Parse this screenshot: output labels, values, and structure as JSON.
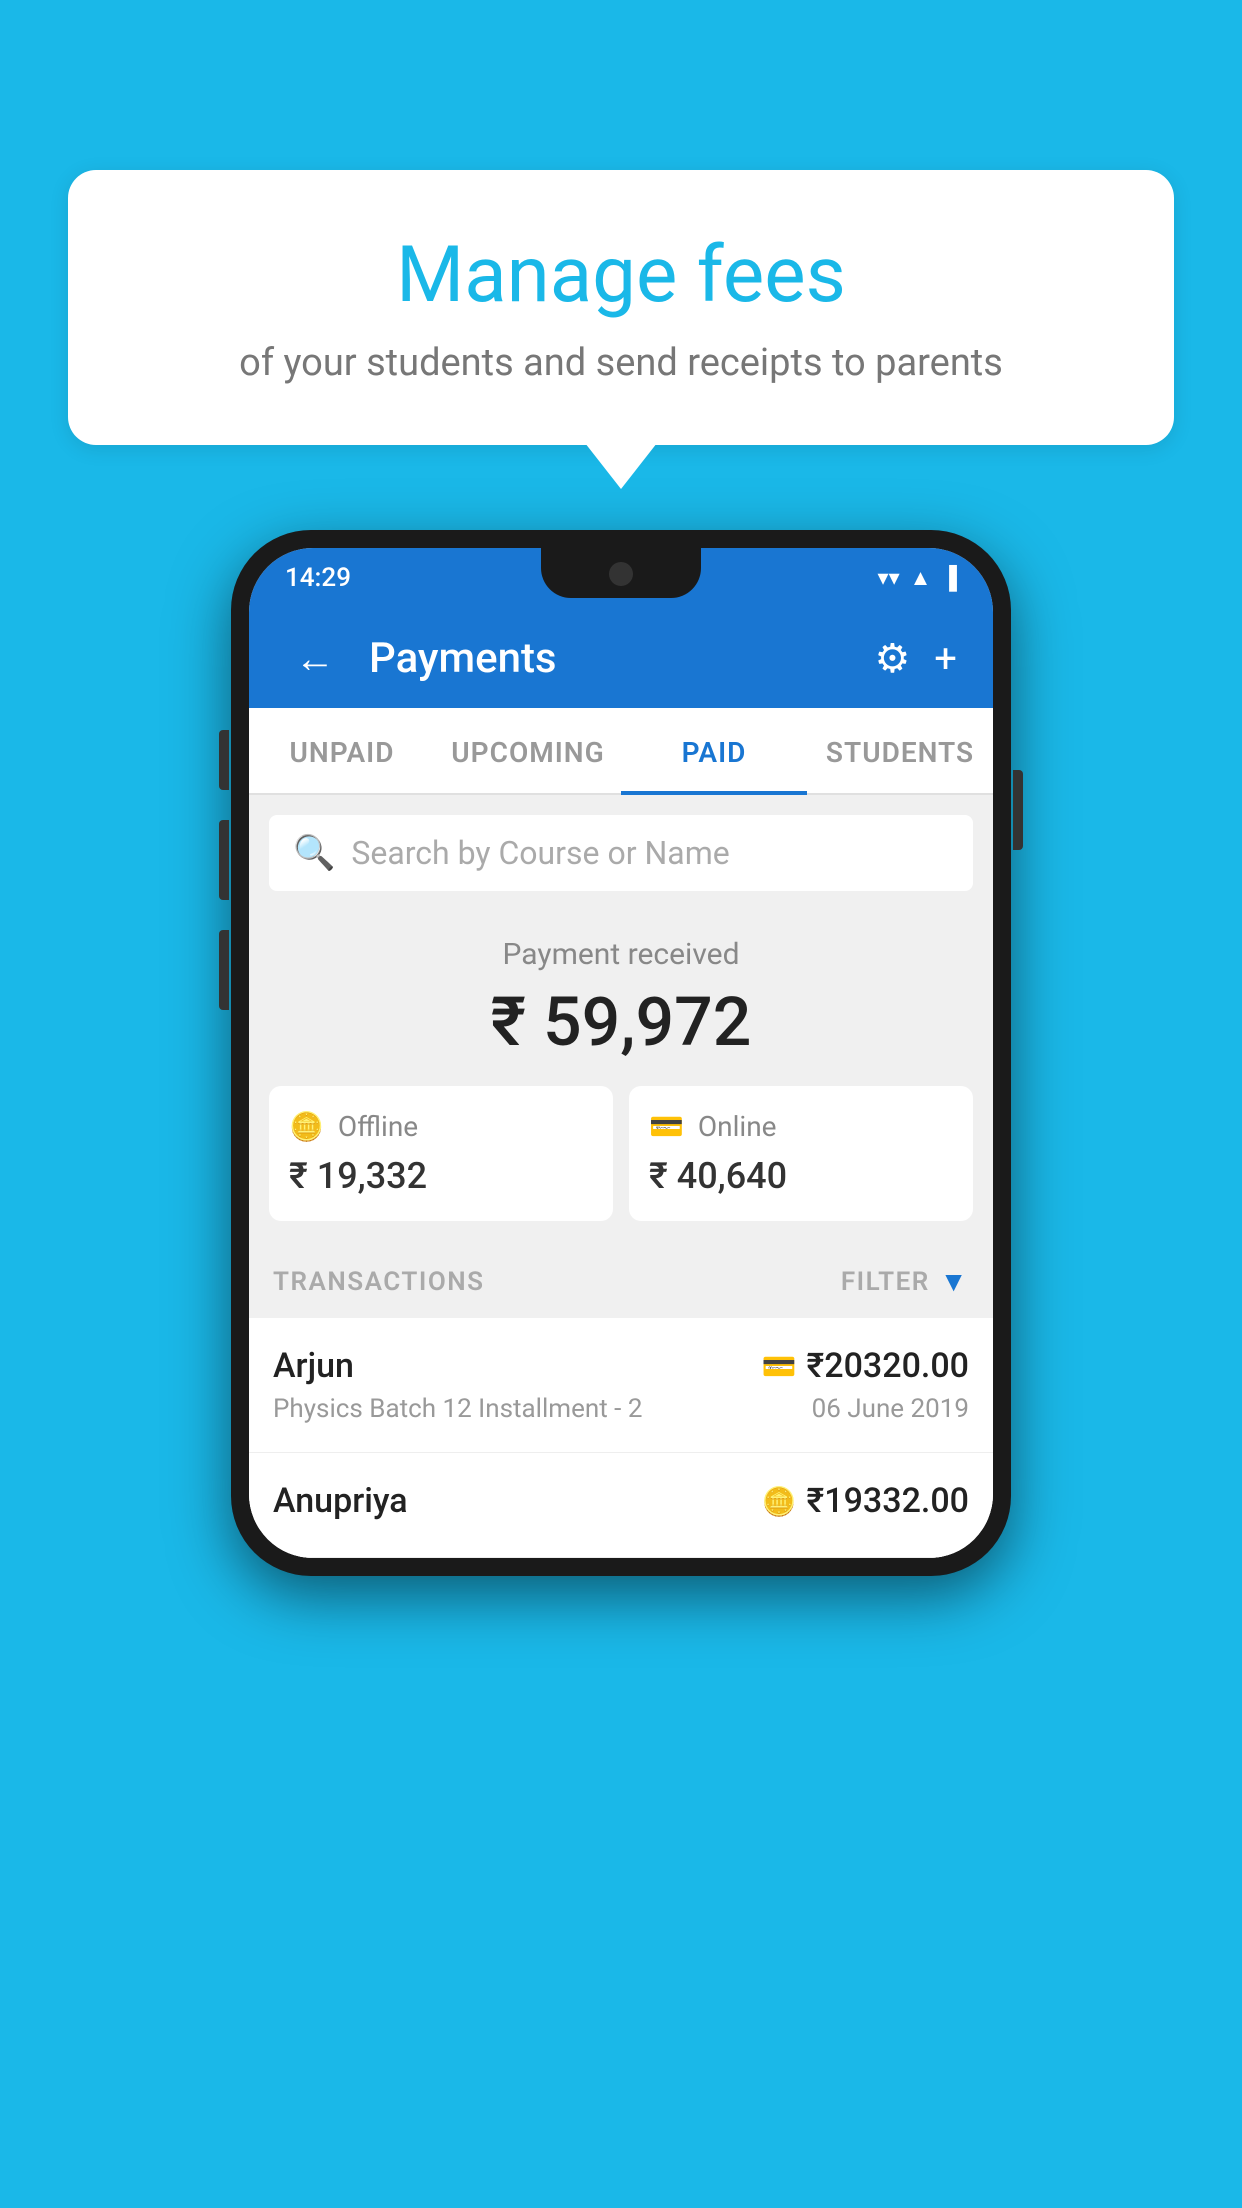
{
  "page": {
    "background_color": "#1ab8e8"
  },
  "bubble": {
    "title": "Manage fees",
    "subtitle": "of your students and send receipts to parents"
  },
  "status_bar": {
    "time": "14:29",
    "wifi": "▼",
    "signal": "▲",
    "battery": "▐"
  },
  "app_bar": {
    "title": "Payments",
    "back_icon": "←",
    "gear_icon": "⚙",
    "plus_icon": "+"
  },
  "tabs": [
    {
      "label": "UNPAID",
      "active": false
    },
    {
      "label": "UPCOMING",
      "active": false
    },
    {
      "label": "PAID",
      "active": true
    },
    {
      "label": "STUDENTS",
      "active": false
    }
  ],
  "search": {
    "placeholder": "Search by Course or Name",
    "icon": "🔍"
  },
  "payment": {
    "label": "Payment received",
    "amount": "₹ 59,972",
    "offline_label": "Offline",
    "offline_amount": "₹ 19,332",
    "online_label": "Online",
    "online_amount": "₹ 40,640"
  },
  "transactions": {
    "header_label": "TRANSACTIONS",
    "filter_label": "FILTER",
    "rows": [
      {
        "name": "Arjun",
        "course": "Physics Batch 12 Installment - 2",
        "date": "06 June 2019",
        "amount": "₹20320.00",
        "payment_icon": "💳",
        "payment_type": "online"
      },
      {
        "name": "Anupriya",
        "course": "",
        "date": "",
        "amount": "₹19332.00",
        "payment_icon": "💵",
        "payment_type": "offline"
      }
    ]
  }
}
